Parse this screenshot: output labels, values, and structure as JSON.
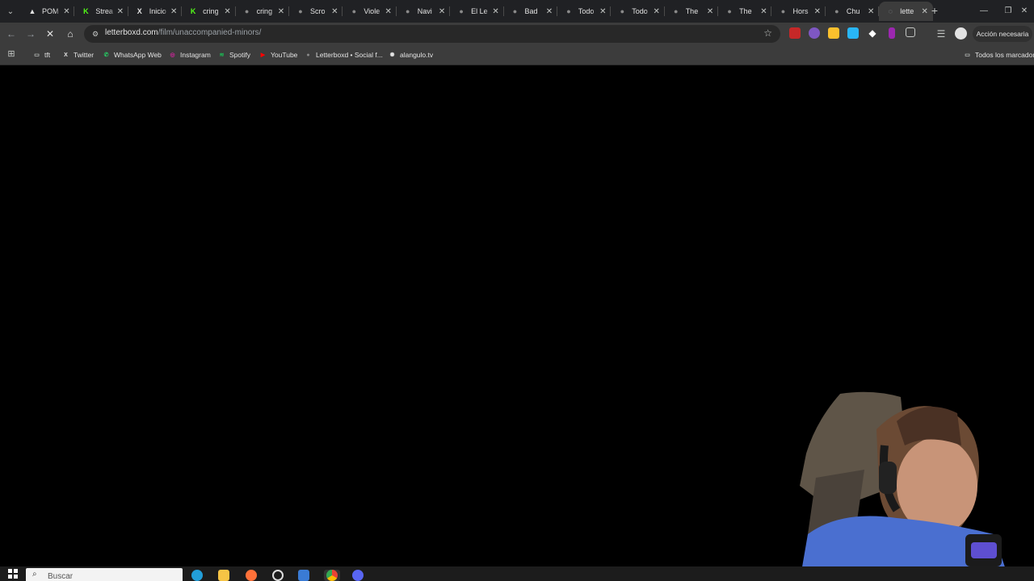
{
  "tabs": [
    {
      "title": "POM",
      "icon": "pom-icon",
      "color": "#e3e3e3",
      "glyph": "▲"
    },
    {
      "title": "Strea",
      "icon": "kick-icon",
      "color": "#53fc18",
      "glyph": "K"
    },
    {
      "title": "Inicio",
      "icon": "x-icon",
      "color": "#e3e3e3",
      "glyph": "X"
    },
    {
      "title": "cring",
      "icon": "kick-icon",
      "color": "#53fc18",
      "glyph": "K"
    },
    {
      "title": "cring",
      "icon": "letterboxd-icon",
      "color": "#8a8a8a",
      "glyph": "●"
    },
    {
      "title": "Scro",
      "icon": "letterboxd-icon",
      "color": "#8a8a8a",
      "glyph": "●"
    },
    {
      "title": "Viole",
      "icon": "letterboxd-icon",
      "color": "#8a8a8a",
      "glyph": "●"
    },
    {
      "title": "Navi",
      "icon": "letterboxd-icon",
      "color": "#8a8a8a",
      "glyph": "●"
    },
    {
      "title": "El Le",
      "icon": "letterboxd-icon",
      "color": "#8a8a8a",
      "glyph": "●"
    },
    {
      "title": "Bad",
      "icon": "letterboxd-icon",
      "color": "#8a8a8a",
      "glyph": "●"
    },
    {
      "title": "Todo",
      "icon": "letterboxd-icon",
      "color": "#8a8a8a",
      "glyph": "●"
    },
    {
      "title": "Todo",
      "icon": "letterboxd-icon",
      "color": "#8a8a8a",
      "glyph": "●"
    },
    {
      "title": "The",
      "icon": "letterboxd-icon",
      "color": "#8a8a8a",
      "glyph": "●"
    },
    {
      "title": "The",
      "icon": "letterboxd-icon",
      "color": "#8a8a8a",
      "glyph": "●"
    },
    {
      "title": "Hors",
      "icon": "letterboxd-icon",
      "color": "#8a8a8a",
      "glyph": "●"
    },
    {
      "title": "Chu",
      "icon": "letterboxd-icon",
      "color": "#8a8a8a",
      "glyph": "●"
    },
    {
      "title": "lette",
      "icon": "loading-icon",
      "color": "#9aa0a6",
      "glyph": "◌",
      "active": true
    }
  ],
  "address": {
    "host": "letterboxd.com",
    "path": "/film/unaccompanied-minors/"
  },
  "toolbar": {
    "action_needed": "Acción necesaria"
  },
  "bookmarks": [
    {
      "label": "tft",
      "icon": "folder-icon",
      "color": "#c4c7c5",
      "glyph": "▭"
    },
    {
      "label": "Twitter",
      "icon": "x-icon",
      "color": "#e3e3e3",
      "glyph": "X"
    },
    {
      "label": "WhatsApp Web",
      "icon": "whatsapp-icon",
      "color": "#25d366",
      "glyph": "✆"
    },
    {
      "label": "Instagram",
      "icon": "instagram-icon",
      "color": "#d6249f",
      "glyph": "◎"
    },
    {
      "label": "Spotify",
      "icon": "spotify-icon",
      "color": "#1db954",
      "glyph": "≋"
    },
    {
      "label": "YouTube",
      "icon": "youtube-icon",
      "color": "#ff0000",
      "glyph": "▶"
    },
    {
      "label": "Letterboxd • Social f...",
      "icon": "letterboxd-icon",
      "color": "#8a8a8a",
      "glyph": "●"
    },
    {
      "label": "alangulo.tv",
      "icon": "alangulo-icon",
      "color": "#e3e3e3",
      "glyph": "✺"
    }
  ],
  "all_bookmarks": "Todos los marcadores",
  "taskbar": {
    "search_placeholder": "Buscar"
  }
}
